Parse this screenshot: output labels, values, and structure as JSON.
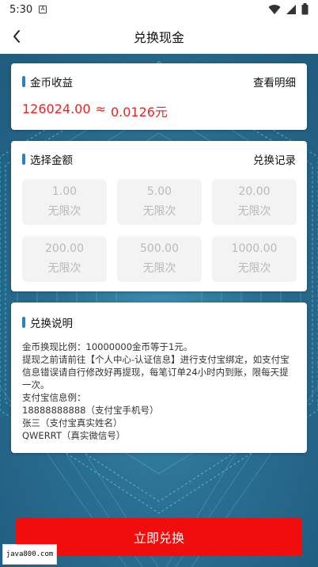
{
  "status_bar": {
    "time": "5:30",
    "icons": [
      "sim-card-icon",
      "wifi-icon",
      "signal-icon",
      "battery-icon"
    ]
  },
  "nav": {
    "title": "兑换现金",
    "back_icon": "chevron-left-icon"
  },
  "income_card": {
    "title": "金币收益",
    "detail_link": "查看明细",
    "coins": "126024.00",
    "approx": "≈",
    "cash": "0.0126元"
  },
  "amount_card": {
    "title": "选择金额",
    "record_link": "兑换记录",
    "options": [
      {
        "value": "1.00",
        "limit": "无限次"
      },
      {
        "value": "5.00",
        "limit": "无限次"
      },
      {
        "value": "20.00",
        "limit": "无限次"
      },
      {
        "value": "200.00",
        "limit": "无限次"
      },
      {
        "value": "500.00",
        "limit": "无限次"
      },
      {
        "value": "1000.00",
        "limit": "无限次"
      }
    ]
  },
  "instructions_card": {
    "title": "兑换说明",
    "lines": [
      "金币换现比例：10000000金币等于1元。",
      "提现之前请前往【个人中心-认证信息】进行支付宝绑定，如支付宝信息错误请自行修改好再提现，每笔订单24小时内到账，限每天提一次。",
      "支付宝信息例：",
      "18888888888（支付宝手机号）",
      "张三（支付宝真实姓名）",
      "QWERRT（真实微信号）"
    ]
  },
  "submit_label": "立即兑换",
  "watermark": "java800.com",
  "colors": {
    "accent_blue": "#2a7fc1",
    "income_red": "#e52525",
    "button_red": "#f20d0d",
    "background_blue": "#2a6f92"
  }
}
